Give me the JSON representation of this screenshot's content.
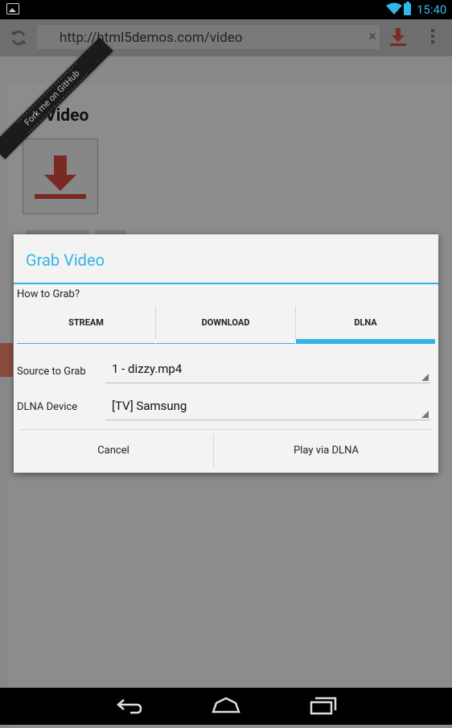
{
  "status_bar": {
    "time": "15:40",
    "accent_color": "#33b5e5",
    "icons": [
      "gallery-icon",
      "wifi-icon",
      "battery-icon"
    ]
  },
  "toolbar": {
    "url": "http://html5demos.com/video",
    "clear_label": "×",
    "icons": [
      "refresh-icon",
      "download-icon",
      "overflow-menu-icon"
    ]
  },
  "page": {
    "title": "Video",
    "ribbon": "Fork me on GitHub",
    "download_color": "#d9534f"
  },
  "dialog": {
    "title": "Grab Video",
    "how_to_label": "How to Grab?",
    "tabs": [
      {
        "label": "STREAM",
        "active": false
      },
      {
        "label": "DOWNLOAD",
        "active": false
      },
      {
        "label": "DLNA",
        "active": true
      }
    ],
    "source": {
      "label": "Source to Grab",
      "value": "1 - dizzy.mp4"
    },
    "device": {
      "label": "DLNA Device",
      "value": "[TV] Samsung"
    },
    "cancel_label": "Cancel",
    "confirm_label": "Play via DLNA"
  },
  "nav_bar": {
    "icons": [
      "back-icon",
      "home-icon",
      "recent-apps-icon"
    ]
  }
}
